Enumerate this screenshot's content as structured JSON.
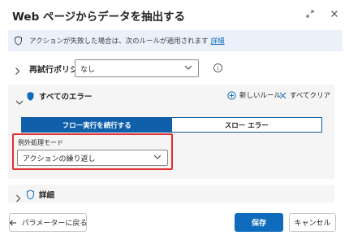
{
  "dialog": {
    "title": "Web ページからデータを抽出する"
  },
  "banner": {
    "text": "アクションが失敗した場合は、次のルールが適用されます",
    "link": "詳細"
  },
  "retry": {
    "label": "再試行ポリシー",
    "value": "なし"
  },
  "errors": {
    "title": "すべてのエラー",
    "new_rule": "新しいルール",
    "clear_all": "すべてクリア",
    "segments": [
      "フロー実行を続行する",
      "スロー エラー"
    ],
    "selected_segment": 0,
    "mode_label": "例外処理モード",
    "mode_value": "アクションの繰り返し"
  },
  "details": {
    "label": "詳細"
  },
  "footer": {
    "back_label": "パラメーターに戻る",
    "save_label": "保存",
    "cancel_label": "キャンセル"
  },
  "colors": {
    "accent": "#0f6cbd",
    "highlight_border": "#e03030",
    "banner_bg": "#ebf0fa",
    "panel_bg": "#f5f5f5"
  }
}
